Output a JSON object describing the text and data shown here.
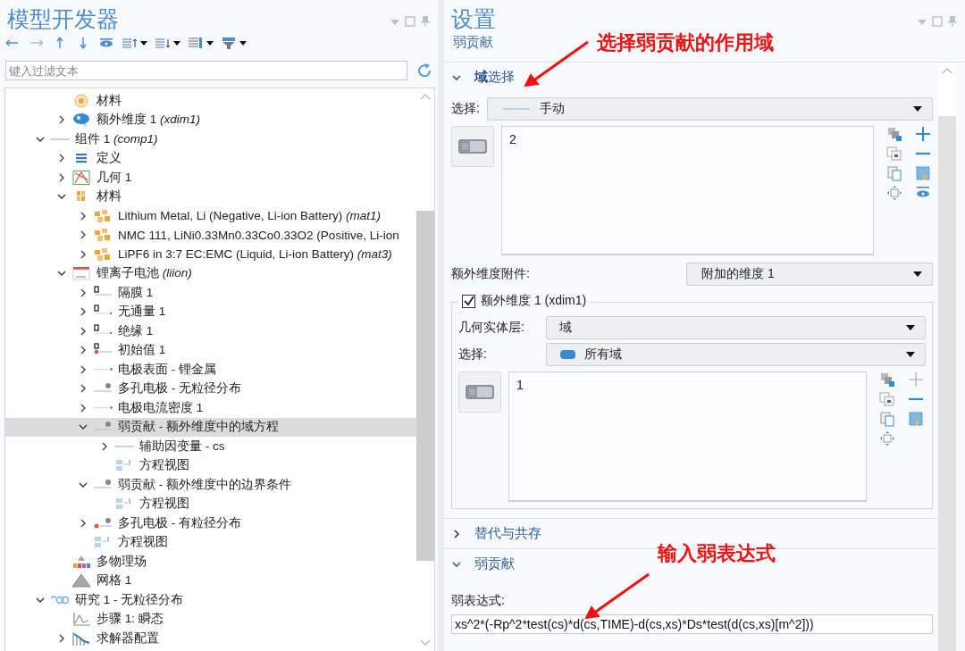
{
  "model_builder": {
    "title": "模型开发器",
    "filter_placeholder": "键入过滤文本",
    "tree": {
      "continued": [
        {
          "label": "材料",
          "selected": false
        },
        {
          "label": "额外维度 1 *(xdim1)*",
          "expanded": false,
          "selected": false
        }
      ],
      "items": [
        {
          "label": "组件 1 *(comp1)*",
          "expanded": true,
          "selected": false,
          "children": [
            {
              "label": "定义",
              "expanded": false,
              "selected": false
            },
            {
              "label": "几何 1",
              "expanded": false,
              "selected": false
            },
            {
              "label": "材料",
              "expanded": true,
              "selected": false,
              "children": [
                {
                  "label": "Lithium Metal, Li (Negative, Li-ion Battery) *(mat1)*",
                  "expanded": false,
                  "selected": false
                },
                {
                  "label": "NMC 111, LiNi0.33Mn0.33Co0.33O2 (Positive, Li-ion",
                  "expanded": false,
                  "selected": false
                },
                {
                  "label": "LiPF6 in 3:7 EC:EMC (Liquid, Li-ion Battery) *(mat3)*",
                  "expanded": false,
                  "selected": false
                }
              ]
            },
            {
              "label": "锂离子电池 *(liion)*",
              "expanded": true,
              "selected": false,
              "children": [
                {
                  "label": "隔膜 1",
                  "expanded": false,
                  "selected": false
                },
                {
                  "label": "无通量 1",
                  "expanded": false,
                  "selected": false
                },
                {
                  "label": "绝缘 1",
                  "expanded": false,
                  "selected": false
                },
                {
                  "label": "初始值 1",
                  "expanded": false,
                  "selected": false
                },
                {
                  "label": "电极表面 - 锂金属",
                  "expanded": false,
                  "selected": false
                },
                {
                  "label": "多孔电极 - 无粒径分布",
                  "expanded": false,
                  "selected": false
                },
                {
                  "label": "电极电流密度 1",
                  "expanded": false,
                  "selected": false
                },
                {
                  "label": "弱贡献 - 额外维度中的域方程",
                  "expanded": true,
                  "selected": true,
                  "children": [
                    {
                      "label": "辅助因变量 - cs",
                      "expanded": false,
                      "selected": false
                    },
                    {
                      "label": "方程视图",
                      "selected": false
                    }
                  ]
                },
                {
                  "label": "弱贡献 - 额外维度中的边界条件",
                  "expanded": true,
                  "selected": false,
                  "children": [
                    {
                      "label": "方程视图",
                      "selected": false
                    }
                  ]
                },
                {
                  "label": "多孔电极 - 有粒径分布",
                  "expanded": false,
                  "selected": false
                },
                {
                  "label": "方程视图",
                  "selected": false
                }
              ]
            },
            {
              "label": "多物理场",
              "selected": false
            },
            {
              "label": "网格 1",
              "selected": false
            }
          ]
        },
        {
          "label": "研究 1 - 无粒径分布",
          "expanded": true,
          "selected": false,
          "children": [
            {
              "label": "步骤 1: 瞬态",
              "selected": false
            },
            {
              "label": "求解器配置",
              "expanded": false,
              "selected": false
            }
          ]
        }
      ]
    }
  },
  "settings": {
    "title": "设置",
    "subtitle": "弱贡献",
    "sections": [
      {
        "kind": "domain_selection",
        "title": "**域**选择",
        "expanded": true,
        "selection_label": "选择:",
        "selection_value": "手动",
        "list_items": [
          "2"
        ],
        "attachment_label": "额外维度附件:",
        "attachment_value": "附加的维度 1",
        "xdim": {
          "label": "额外维度 1 (xdim1)",
          "checked": true,
          "level_label": "几何实体层:",
          "level_value": "域",
          "selection_label": "选择:",
          "selection_value": "所有域",
          "list_items": [
            "1"
          ]
        }
      },
      {
        "title": "替代与共存",
        "expanded": false
      },
      {
        "kind": "weak_contribution",
        "title": "弱贡献",
        "expanded": true,
        "expression_label": "弱表达式:",
        "expression_value": "xs^2*(-Rp^2*test(cs)*d(cs,TIME)-d(cs,xs)*Ds*test(d(cs,xs)[m^2]))"
      }
    ]
  },
  "annotations": [
    {
      "text": "选择弱贡献的作用域"
    },
    {
      "text": "输入弱表达式"
    }
  ]
}
